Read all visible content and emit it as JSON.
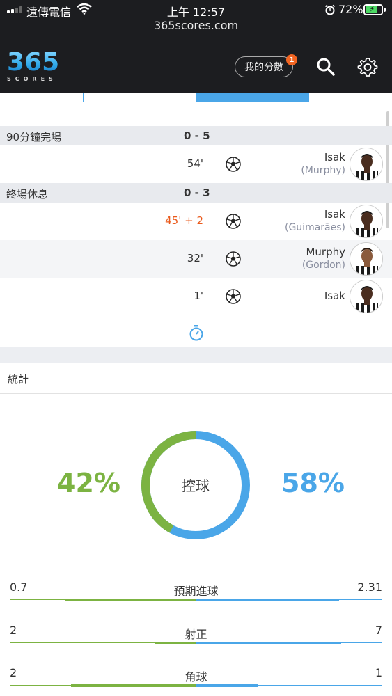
{
  "status_bar": {
    "carrier": "遠傳電信",
    "time": "上午 12:57",
    "battery": "72%",
    "url": "365scores.com"
  },
  "header": {
    "logo_number": "365",
    "logo_sub": "SCORES",
    "my_scores_label": "我的分數",
    "my_scores_badge": "1"
  },
  "events": {
    "periods": [
      {
        "label": "90分鐘完場",
        "score": "0 - 5"
      },
      {
        "label": "終場休息",
        "score": "0 - 3"
      }
    ],
    "goals": [
      {
        "minute": "54'",
        "player": "Isak",
        "assist": "(Murphy)",
        "late": false
      },
      {
        "minute": "45' + 2",
        "player": "Isak",
        "assist": "(Guimarães)",
        "late": true
      },
      {
        "minute": "32'",
        "player": "Murphy",
        "assist": "(Gordon)",
        "late": false
      },
      {
        "minute": "1'",
        "player": "Isak",
        "assist": "",
        "late": false
      }
    ]
  },
  "stats": {
    "title": "統計",
    "possession": {
      "label": "控球",
      "home": "42%",
      "away": "58%",
      "home_fraction": 0.42
    },
    "rows": [
      {
        "name": "預期進球",
        "home": "0.7",
        "away": "2.31"
      },
      {
        "name": "射正",
        "home": "2",
        "away": "7"
      },
      {
        "name": "角球",
        "home": "2",
        "away": "1"
      }
    ]
  },
  "colors": {
    "home": "#7cb342",
    "away": "#4aa6e8",
    "late_minute": "#ea5a1c",
    "header_bg": "#1c1d20"
  }
}
